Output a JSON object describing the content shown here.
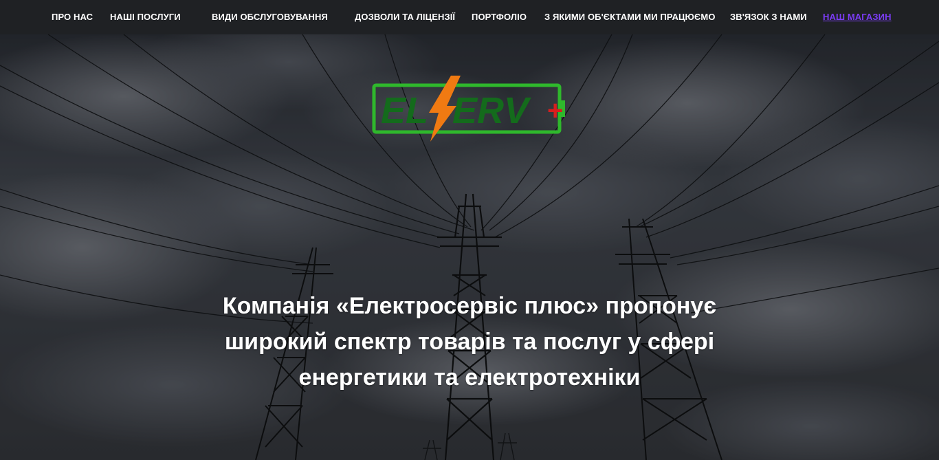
{
  "nav": {
    "items": [
      {
        "label": "ПРО НАС"
      },
      {
        "label": "НАШІ ПОСЛУГИ"
      },
      {
        "label": "ВИДИ ОБСЛУГОВУВАННЯ"
      },
      {
        "label": "ДОЗВОЛИ ТА ЛІЦЕНЗІЇ"
      },
      {
        "label": "ПОРТФОЛІО"
      },
      {
        "label": "З ЯКИМИ ОБ'ЄКТАМИ МИ ПРАЦЮЄМО"
      },
      {
        "label": "ЗВ'ЯЗОК З НАМИ"
      },
      {
        "label": "НАШ МАГАЗИН",
        "active": true
      }
    ]
  },
  "logo": {
    "text_left": "EL",
    "text_right": "ERV",
    "plus": "+"
  },
  "hero": {
    "headline": "Компанія «Електросервіс плюс» пропонує широкий спектр товарів та послуг у сфері енергетики та електротехніки"
  },
  "colors": {
    "nav_bg": "#1f2124",
    "nav_active": "#7b3cf5",
    "logo_green": "#2fb82c",
    "logo_dark_green": "#146b1c",
    "logo_orange": "#f07a12",
    "logo_red": "#d81e1e"
  }
}
